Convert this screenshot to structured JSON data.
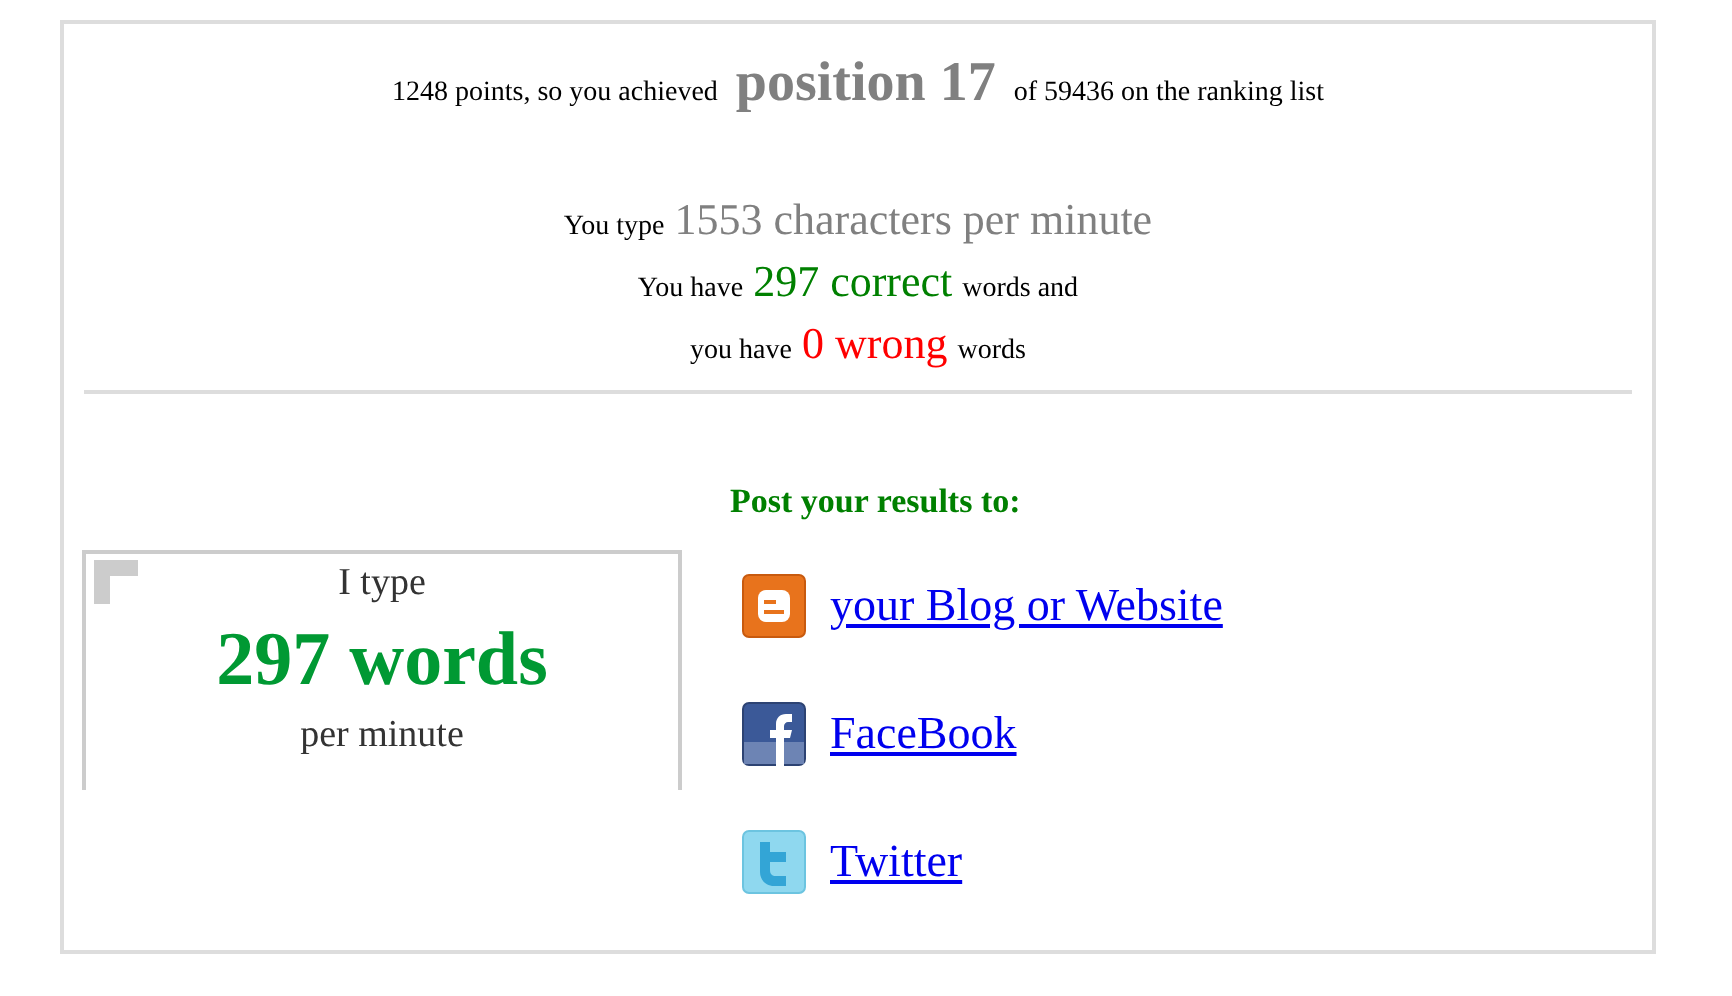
{
  "ranking": {
    "before": "1248 points, so you achieved",
    "position": "position 17",
    "after": "of 59436 on the ranking list"
  },
  "stats": [
    {
      "prefix": "You type",
      "value": "1553 characters per minute",
      "color": "#808080"
    },
    {
      "prefix": "You have",
      "value": "297 correct",
      "suffix": "words and",
      "color": "#008000"
    },
    {
      "prefix": "you have",
      "value": "0 wrong",
      "suffix": "words",
      "color": "#ff0000"
    }
  ],
  "badge": {
    "top": "I type",
    "main": "297 words",
    "bottom": "per minute"
  },
  "share": {
    "heading": "Post your results to:",
    "links": [
      {
        "kind": "blogger",
        "label": "your Blog or Website"
      },
      {
        "kind": "facebook",
        "label": "FaceBook"
      },
      {
        "kind": "twitter",
        "label": "Twitter"
      }
    ]
  }
}
